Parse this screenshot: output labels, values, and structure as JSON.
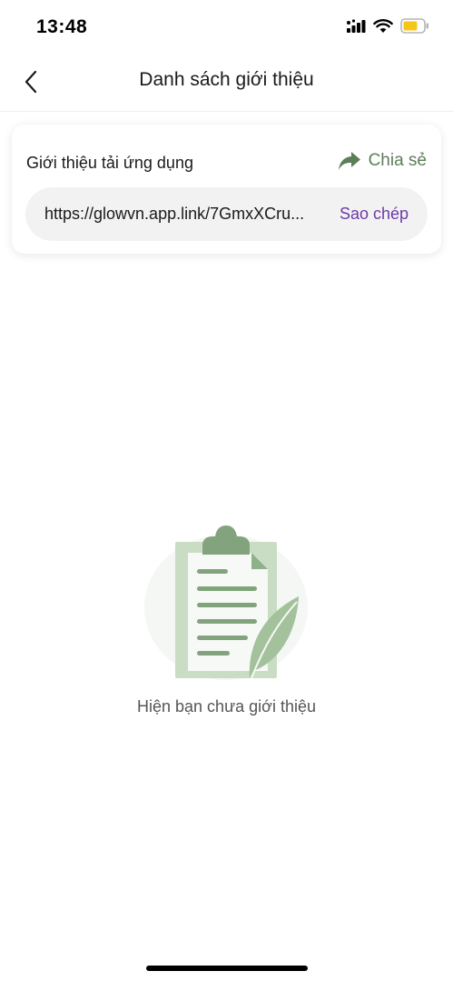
{
  "status_bar": {
    "time": "13:48",
    "battery_color": "#f5c518"
  },
  "header": {
    "title": "Danh sách giới thiệu",
    "back_icon": "chevron-left-icon"
  },
  "referral_card": {
    "title": "Giới thiệu tải ứng dụng",
    "share_label": "Chia sẻ",
    "share_icon": "share-arrow-icon",
    "link": "https://glowvn.app.link/7GmxXCru...",
    "copy_label": "Sao chép"
  },
  "empty_state": {
    "icon": "clipboard-feather-icon",
    "message": "Hiện bạn chưa giới thiệu"
  },
  "colors": {
    "accent_green": "#5e7d5a",
    "accent_purple": "#6b3aa8"
  }
}
